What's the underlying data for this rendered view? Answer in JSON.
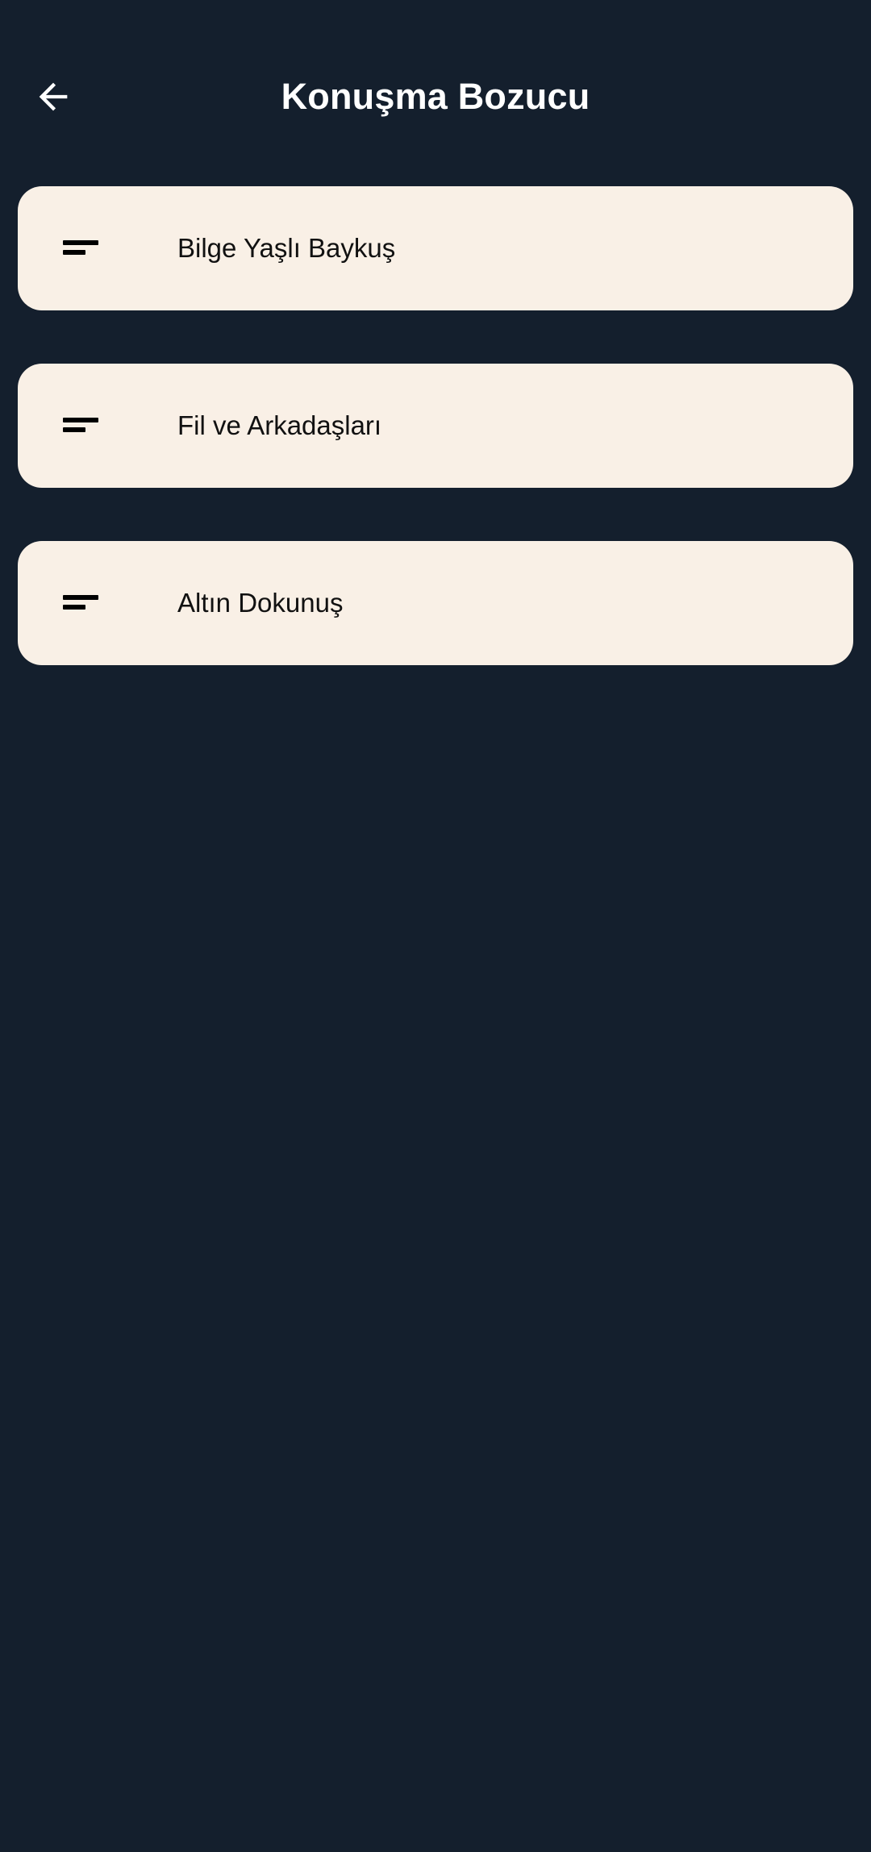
{
  "app_bar": {
    "back_icon": "arrow-left-icon",
    "title": "Konuşma Bozucu"
  },
  "stories": [
    {
      "icon": "short-text-icon",
      "title": "Bilge Yaşlı Baykuş"
    },
    {
      "icon": "short-text-icon",
      "title": "Fil ve Arkadaşları"
    },
    {
      "icon": "short-text-icon",
      "title": "Altın Dokunuş"
    }
  ],
  "colors": {
    "background": "#141F2D",
    "card": "#F9F0E6",
    "title_text": "#FFFFFF",
    "card_text": "#111111"
  }
}
